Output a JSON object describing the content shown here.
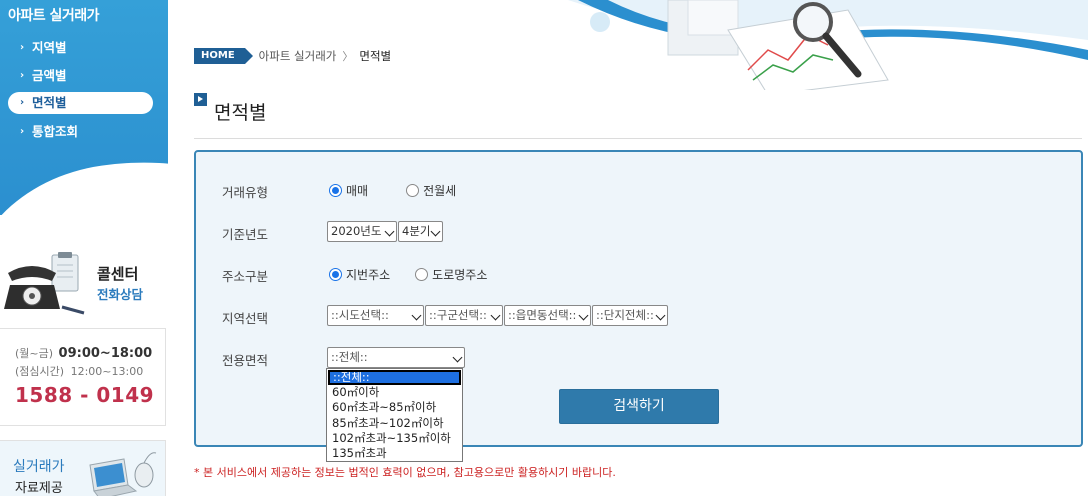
{
  "sidebar": {
    "title": "아파트 실거래가",
    "items": [
      {
        "label": "지역별"
      },
      {
        "label": "금액별"
      },
      {
        "label": "면적별"
      },
      {
        "label": "통합조회"
      }
    ],
    "callcenter": {
      "title": "콜센터",
      "subtitle": "전화상담"
    },
    "hours": {
      "weekday_label": "(월~금)",
      "weekday_time": "09:00~18:00",
      "lunch_label": "(점심시간)",
      "lunch_time": "12:00~13:00",
      "phone": "1588 - 0149"
    },
    "data_service": {
      "title": "실거래가",
      "subtitle": "자료제공"
    }
  },
  "breadcrumb": {
    "home": "HOME",
    "section": "아파트 실거래가",
    "current": "면적별"
  },
  "page_title": "면적별",
  "form": {
    "trade_type": {
      "label": "거래유형",
      "options": [
        "매매",
        "전월세"
      ],
      "selected": "매매"
    },
    "base_year": {
      "label": "기준년도",
      "year_value": "2020년도",
      "quarter_value": "4분기"
    },
    "address_type": {
      "label": "주소구분",
      "options": [
        "지번주소",
        "도로명주소"
      ],
      "selected": "지번주소"
    },
    "region": {
      "label": "지역선택",
      "sido": "::시도선택::",
      "gugun": "::구군선택::",
      "dong": "::읍면동선택::",
      "complex": "::단지전체::"
    },
    "area": {
      "label": "전용면적",
      "value": "::전체::",
      "options": [
        "::전체::",
        "60㎡이하",
        "60㎡초과~85㎡이하",
        "85㎡초과~102㎡이하",
        "102㎡초과~135㎡이하",
        "135㎡초과"
      ]
    },
    "search_button": "검색하기"
  },
  "disclaimer": "* 본 서비스에서 제공하는 정보는 법적인 효력이 없으며, 참고용으로만 활용하시기 바랍니다.",
  "colors": {
    "primary": "#2b8fcf",
    "dark_blue": "#1f5f95",
    "phone_red": "#c0314c",
    "notice_red": "#cc2222"
  }
}
